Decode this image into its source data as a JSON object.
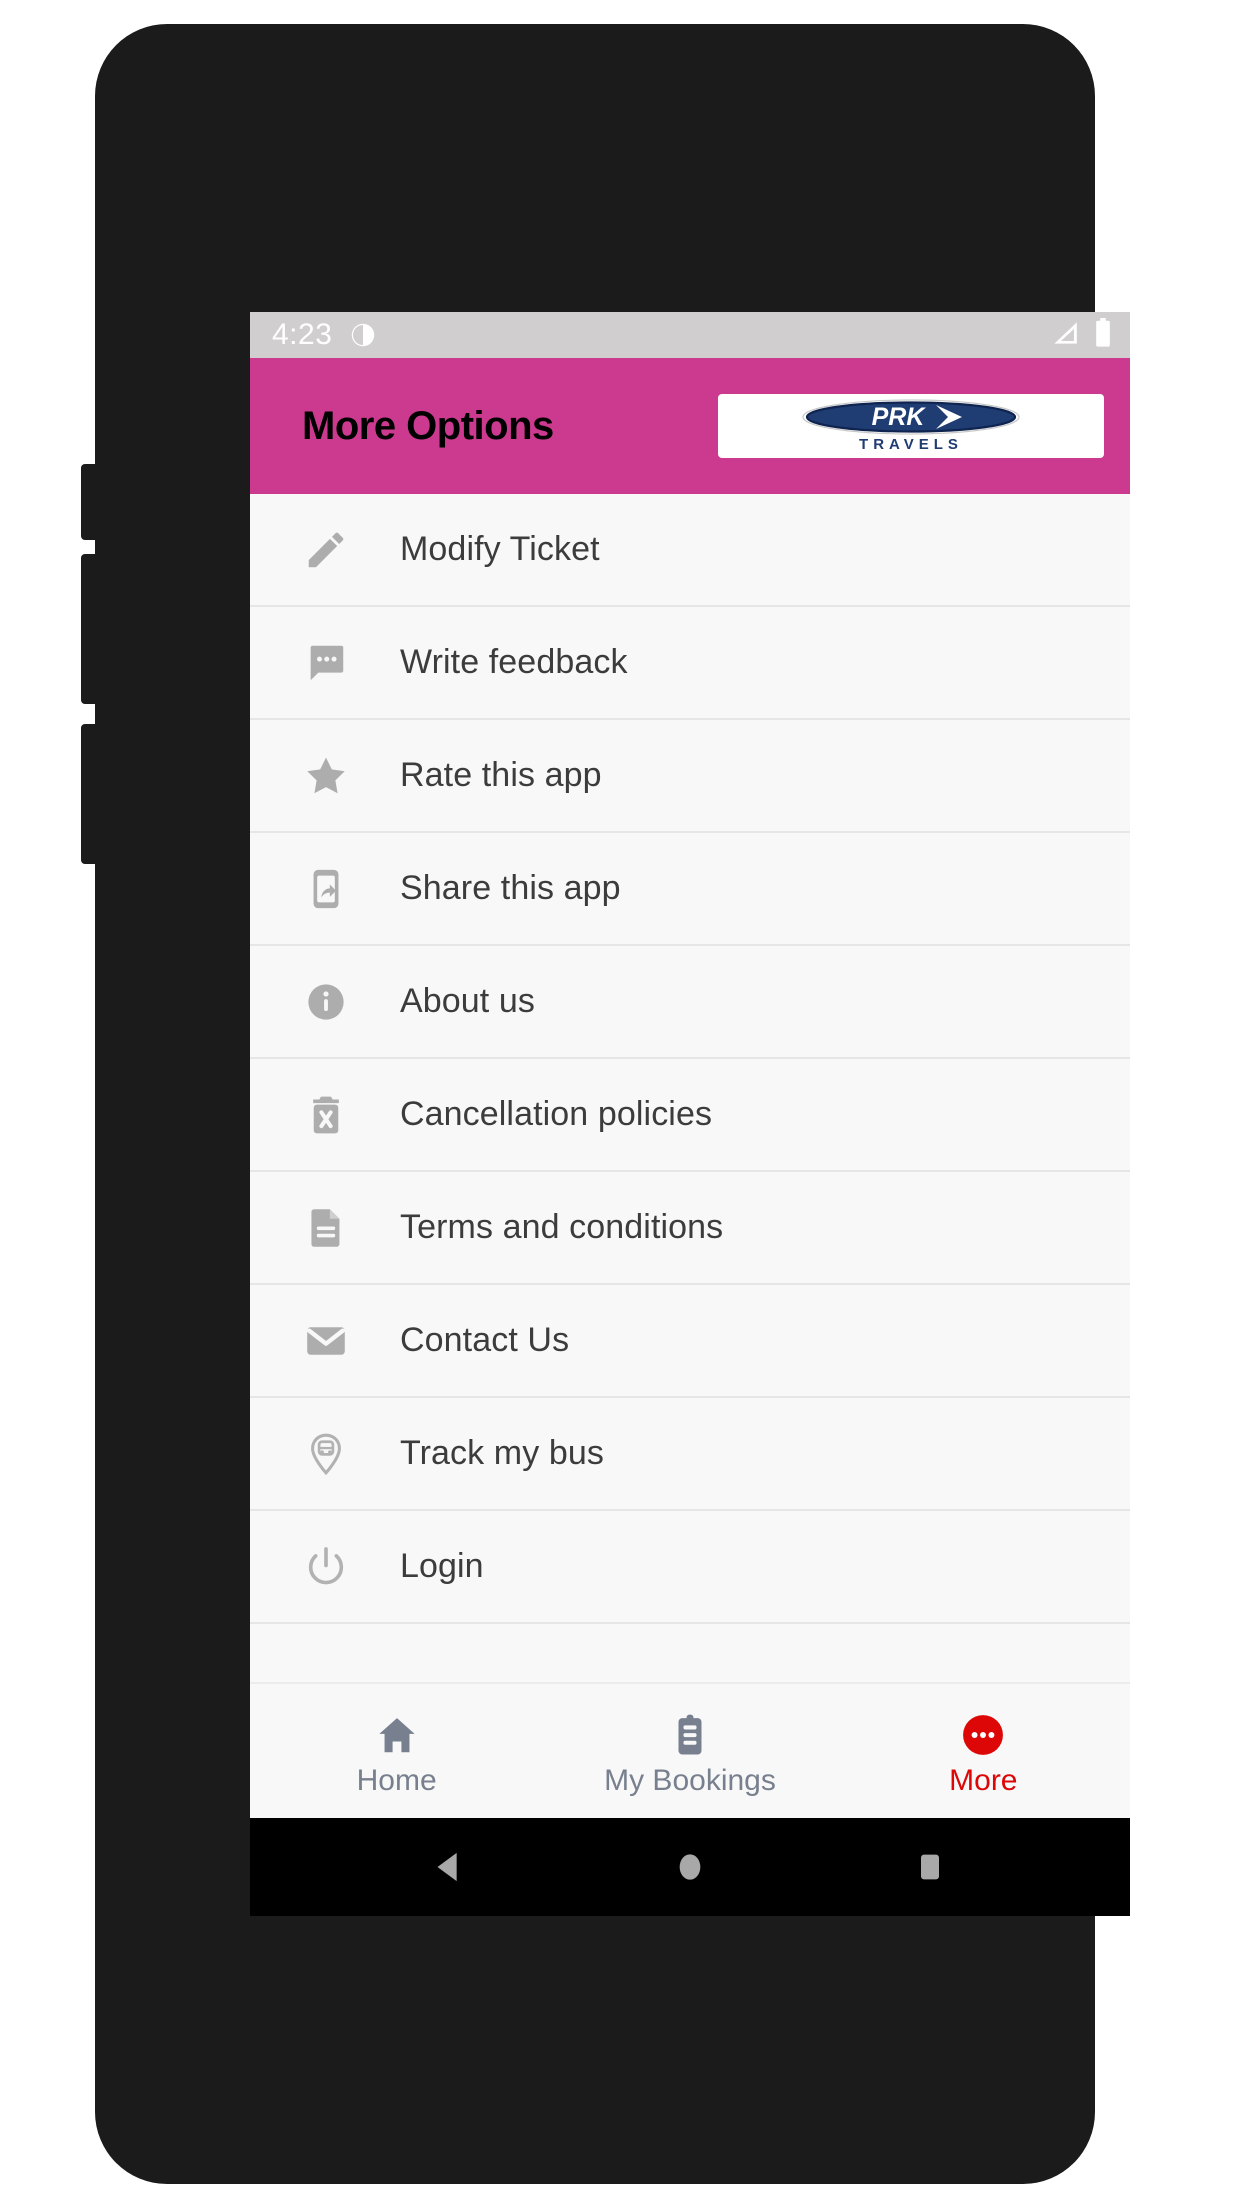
{
  "status_bar": {
    "time": "4:23",
    "left_icon": "notification-dot-icon",
    "signal_icon": "signal-bars-icon",
    "battery_icon": "battery-full-icon"
  },
  "app_bar": {
    "title": "More Options",
    "accent_color": "#cc3a90",
    "brand": {
      "name": "PRK",
      "tagline": "T R A V E L S",
      "logo_color": "#1f3c73"
    }
  },
  "options": [
    {
      "label": "Modify Ticket",
      "icon": "pencil-icon"
    },
    {
      "label": "Write feedback",
      "icon": "comment-dots-icon"
    },
    {
      "label": "Rate this app",
      "icon": "star-icon"
    },
    {
      "label": "Share this app",
      "icon": "share-phone-icon"
    },
    {
      "label": "About us",
      "icon": "info-circle-icon"
    },
    {
      "label": "Cancellation policies",
      "icon": "trash-x-icon"
    },
    {
      "label": "Terms and conditions",
      "icon": "document-icon"
    },
    {
      "label": "Contact Us",
      "icon": "envelope-icon"
    },
    {
      "label": "Track my bus",
      "icon": "map-pin-bus-icon"
    },
    {
      "label": "Login",
      "icon": "power-icon"
    }
  ],
  "bottom_nav": {
    "items": [
      {
        "label": "Home",
        "icon": "home-icon",
        "active": false
      },
      {
        "label": "My Bookings",
        "icon": "clipboard-icon",
        "active": false
      },
      {
        "label": "More",
        "icon": "more-dots-icon",
        "active": true
      }
    ],
    "inactive_color": "#78808f",
    "active_color": "#dd0707"
  },
  "android_nav": {
    "back": "back-triangle-icon",
    "home": "home-circle-icon",
    "recents": "recents-square-icon"
  }
}
